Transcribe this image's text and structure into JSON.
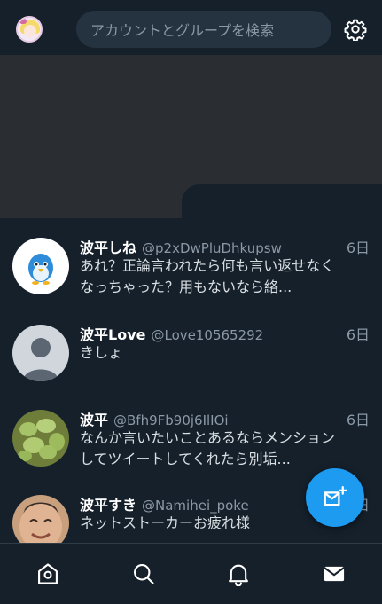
{
  "header": {
    "search_placeholder": "アカウントとグループを検索"
  },
  "icons": {
    "account": "user-avatar-icon",
    "settings": "gear-icon",
    "compose": "new-message-icon",
    "home": "home-icon",
    "search": "search-icon",
    "notifications": "bell-icon",
    "messages": "envelope-icon"
  },
  "colors": {
    "background": "#15202b",
    "accent": "#1d9bf0",
    "secondary_text": "#8b98a5",
    "banner": "#2a2e33"
  },
  "conversations": [
    {
      "display_name": "波平しね",
      "handle": "@p2xDwPluDhkupsw",
      "time": "6日",
      "preview": "あれ？正論言われたら何も言い返せなくなっちゃった？用もないなら絡..."
    },
    {
      "display_name": "波平Love",
      "handle": "@Love10565292",
      "time": "6日",
      "preview": "きしょ"
    },
    {
      "display_name": "波平",
      "handle": "@Bfh9Fb90j6IlIOi",
      "time": "6日",
      "preview": "なんか言いたいことあるならメンションしてツイートしてくれたら別垢..."
    },
    {
      "display_name": "波平すき",
      "handle": "@Namihei_poke",
      "time": "6日",
      "preview": "ネットストーカーお疲れ様"
    }
  ]
}
